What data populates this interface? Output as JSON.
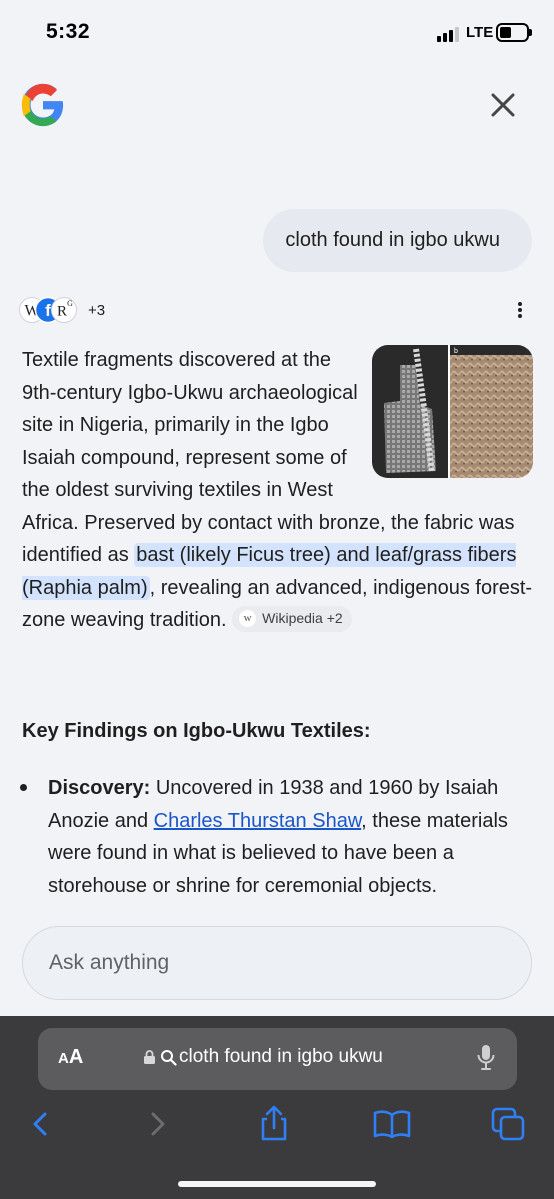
{
  "status_bar": {
    "time": "5:32",
    "network": "LTE",
    "battery_level": 0.45,
    "signal_bars": 3
  },
  "header": {
    "logo": "google-g-logo",
    "close_icon": "close-icon"
  },
  "query": {
    "text": "cloth found in igbo ukwu"
  },
  "sources": {
    "more_count": "+3",
    "logo_text": "W R G"
  },
  "answer": {
    "text_1": "Textile fragments discovered at the 9th-century Igbo-Ukwu archaeological site in Nigeria, primarily in the Igbo Isaiah compound, represent some of the oldest surviving textiles in West Africa. Preserved by contact with bronze, the fabric was identified as ",
    "highlight": "bast (likely Ficus tree) and leaf/grass fibers (Raphia palm)",
    "text_2": ", revealing an advanced, indigenous forest-zone weaving tradition.",
    "chip_label": "Wikipedia +2",
    "chip_letter": "w",
    "image_panel_label": "b"
  },
  "key_findings": {
    "title": "Key Findings on Igbo-Ukwu Textiles:",
    "bullet_label": "Discovery:",
    "bullet_text_1": " Uncovered in 1938 and 1960 by Isaiah Anozie and ",
    "bullet_link": "Charles Thurstan Shaw",
    "bullet_text_2": ", these materials were found in what is believed to have been a storehouse or shrine for ceremonial objects."
  },
  "ask_input": {
    "placeholder": "Ask anything"
  },
  "safari": {
    "aa_small": "A",
    "aa_big": "A",
    "url_text": "cloth found in igbo ukwu",
    "toolbar_icons": [
      "back-icon",
      "forward-icon",
      "share-icon",
      "bookmarks-icon",
      "tabs-icon"
    ]
  },
  "colors": {
    "accent": "#1a56c9",
    "highlight": "#d3e3fd",
    "safari_icon": "#2f7ff5",
    "page_bg": "#f1f3f6"
  }
}
